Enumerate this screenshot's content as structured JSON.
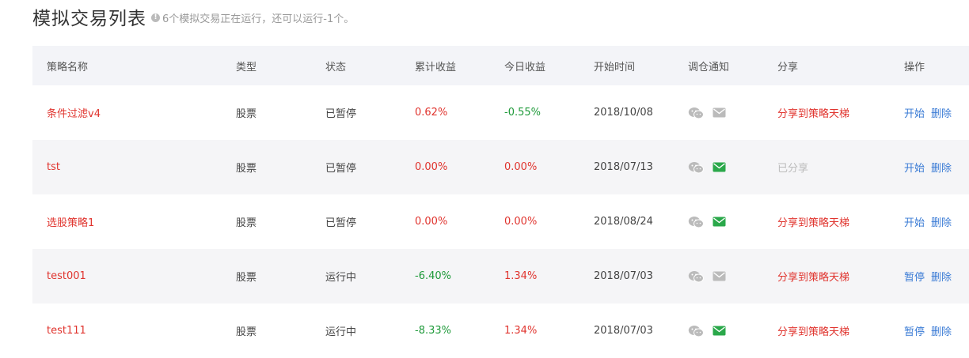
{
  "header": {
    "title": "模拟交易列表",
    "hint": "6个模拟交易正在运行，还可以运行-1个。"
  },
  "table": {
    "columns": [
      "策略名称",
      "类型",
      "状态",
      "累计收益",
      "今日收益",
      "开始时间",
      "调仓通知",
      "分享",
      "操作"
    ],
    "rows": [
      {
        "name": "条件过滤v4",
        "type": "股票",
        "status": "已暂停",
        "cum_return": "0.62%",
        "cum_color": "red",
        "today_return": "-0.55%",
        "today_color": "green",
        "start": "2018/10/08",
        "mail_active": false,
        "share": "分享到策略天梯",
        "share_active": true,
        "action1": "开始",
        "action2": "删除"
      },
      {
        "name": "tst",
        "type": "股票",
        "status": "已暂停",
        "cum_return": "0.00%",
        "cum_color": "red",
        "today_return": "0.00%",
        "today_color": "red",
        "start": "2018/07/13",
        "mail_active": true,
        "share": "已分享",
        "share_active": false,
        "action1": "开始",
        "action2": "删除"
      },
      {
        "name": "选股策略1",
        "type": "股票",
        "status": "已暂停",
        "cum_return": "0.00%",
        "cum_color": "red",
        "today_return": "0.00%",
        "today_color": "red",
        "start": "2018/08/24",
        "mail_active": true,
        "share": "分享到策略天梯",
        "share_active": true,
        "action1": "开始",
        "action2": "删除"
      },
      {
        "name": "test001",
        "type": "股票",
        "status": "运行中",
        "cum_return": "-6.40%",
        "cum_color": "green",
        "today_return": "1.34%",
        "today_color": "red",
        "start": "2018/07/03",
        "mail_active": false,
        "share": "分享到策略天梯",
        "share_active": true,
        "action1": "暂停",
        "action2": "删除"
      },
      {
        "name": "test111",
        "type": "股票",
        "status": "运行中",
        "cum_return": "-8.33%",
        "cum_color": "green",
        "today_return": "1.34%",
        "today_color": "red",
        "start": "2018/07/03",
        "mail_active": true,
        "share": "分享到策略天梯",
        "share_active": true,
        "action1": "暂停",
        "action2": "删除"
      }
    ]
  },
  "colors": {
    "red": "#e0342e",
    "green": "#1f9a3a",
    "blue": "#3a7bd5",
    "icon_gray": "#bbbbbb",
    "mail_active": "#2aa84a"
  },
  "icons": {
    "wechat": "wechat-icon",
    "mail": "mail-icon",
    "info": "info-icon"
  }
}
